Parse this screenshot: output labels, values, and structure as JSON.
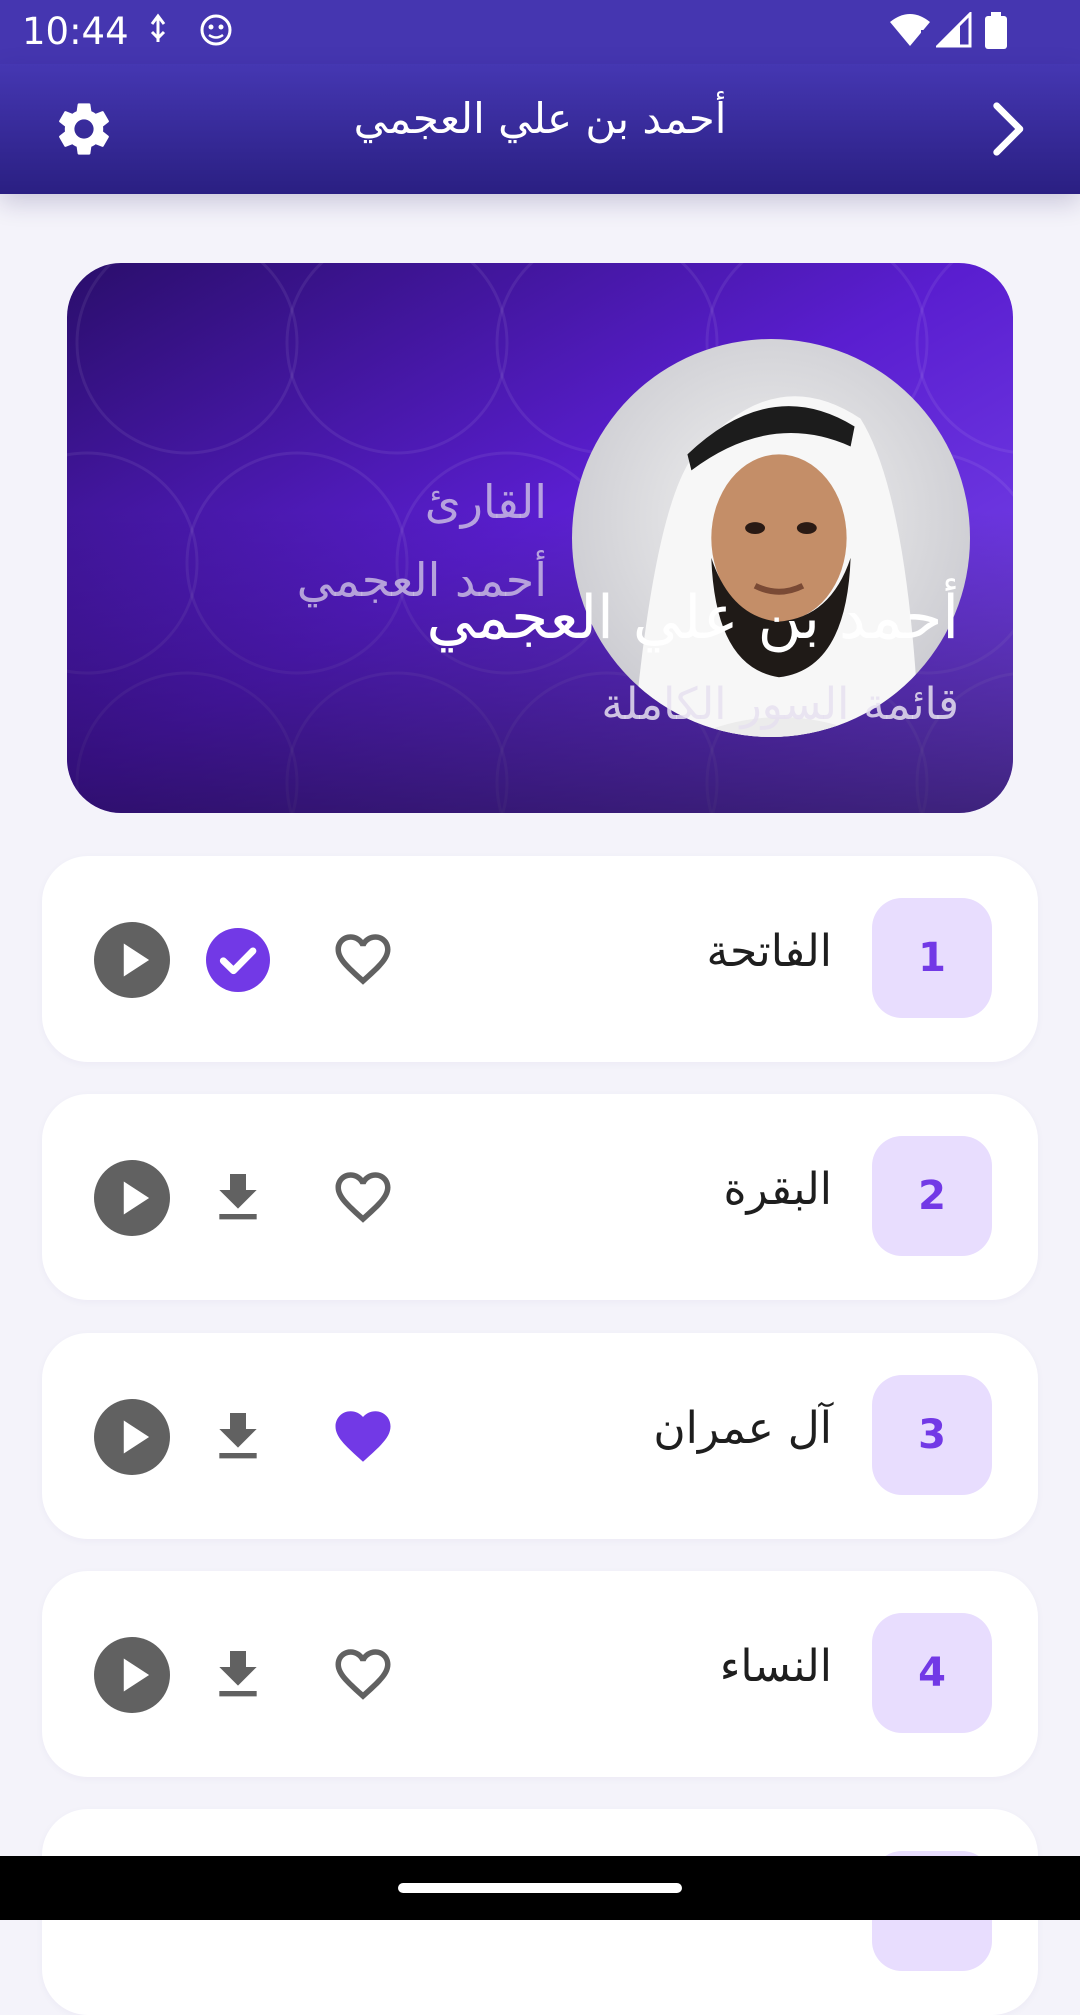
{
  "status_bar": {
    "time": "10:44"
  },
  "app_bar": {
    "title": "أحمد بن علي العجمي"
  },
  "banner": {
    "watermark_line1": "القارئ",
    "watermark_line2": "أحمد العجمي",
    "reciter_name": "أحمد بن علي العجمي",
    "subtitle": "قائمة السور الكاملة"
  },
  "surahs": [
    {
      "number": "1",
      "name": "الفاتحة",
      "downloaded": true,
      "favorite": false
    },
    {
      "number": "2",
      "name": "البقرة",
      "downloaded": false,
      "favorite": false
    },
    {
      "number": "3",
      "name": "آل عمران",
      "downloaded": false,
      "favorite": true
    },
    {
      "number": "4",
      "name": "النساء",
      "downloaded": false,
      "favorite": false
    }
  ],
  "colors": {
    "accent": "#7239e6",
    "badge_bg": "#e8ddfe",
    "icon_gray": "#616161",
    "app_bar": "#3a2d9c"
  },
  "icons": {
    "settings": "gear-icon",
    "back": "chevron-right-icon",
    "play": "play-circle-icon",
    "downloaded": "check-circle-icon",
    "download": "download-icon",
    "favorite": "heart-icon"
  }
}
